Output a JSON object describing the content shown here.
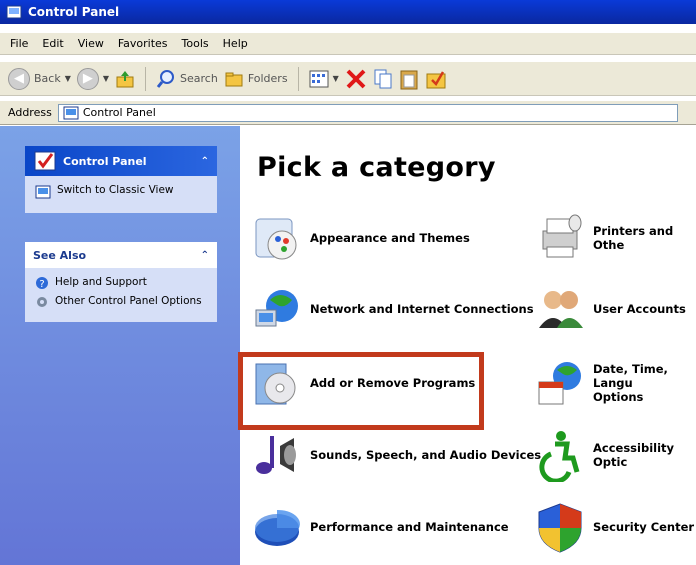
{
  "window": {
    "title": "Control Panel"
  },
  "menubar": [
    "File",
    "Edit",
    "View",
    "Favorites",
    "Tools",
    "Help"
  ],
  "toolbar": {
    "back_label": "Back",
    "search_label": "Search",
    "folders_label": "Folders"
  },
  "address": {
    "label": "Address",
    "value": "Control Panel"
  },
  "sidebar": {
    "panel1": {
      "title": "Control Panel",
      "link": "Switch to Classic View"
    },
    "panel2": {
      "title": "See Also",
      "links": [
        "Help and Support",
        "Other Control Panel Options"
      ]
    }
  },
  "main": {
    "title": "Pick a category",
    "categories_left": [
      "Appearance and Themes",
      "Network and Internet Connections",
      "Add or Remove Programs",
      "Sounds, Speech, and Audio Devices",
      "Performance and Maintenance"
    ],
    "categories_right": [
      "Printers and Othe",
      "User Accounts",
      "Date, Time, Langu\nOptions",
      "Accessibility Optic",
      "Security Center"
    ]
  },
  "colors": {
    "highlight": "#c23a1c",
    "sidebar": "#6f8ee0",
    "title": "#0a3ad8"
  }
}
